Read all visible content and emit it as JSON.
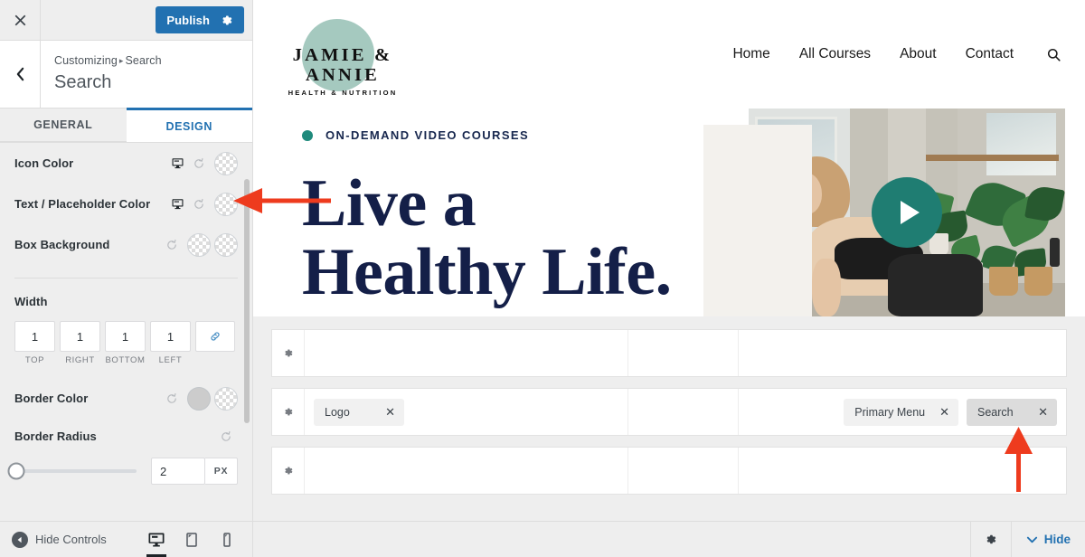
{
  "customizer": {
    "close_icon": "close-icon",
    "publish_label": "Publish",
    "publish_gear_icon": "gear-icon",
    "back_icon": "chevron-left-icon",
    "breadcrumb_prefix": "Customizing",
    "breadcrumb_separator": "▸",
    "breadcrumb_current": "Search",
    "panel_title": "Search",
    "tabs": [
      {
        "label": "GENERAL",
        "active": false
      },
      {
        "label": "DESIGN",
        "active": true
      }
    ],
    "controls": [
      {
        "label": "Icon Color",
        "responsive_icon": "desktop-icon",
        "reset_icon": "reset-icon",
        "swatches": [
          "transparent"
        ]
      },
      {
        "label": "Text / Placeholder Color",
        "responsive_icon": "desktop-icon",
        "reset_icon": "reset-icon",
        "swatches": [
          "transparent"
        ]
      },
      {
        "label": "Box Background",
        "responsive_icon": null,
        "reset_icon": "reset-icon",
        "swatches": [
          "transparent",
          "transparent"
        ]
      }
    ],
    "width": {
      "title": "Width",
      "fields": [
        {
          "value": "1",
          "caption": "TOP"
        },
        {
          "value": "1",
          "caption": "RIGHT"
        },
        {
          "value": "1",
          "caption": "BOTTOM"
        },
        {
          "value": "1",
          "caption": "LEFT"
        }
      ],
      "link_icon": "link-icon"
    },
    "border_color": {
      "label": "Border Color",
      "reset_icon": "reset-icon",
      "swatches": [
        "#cccccc",
        "transparent"
      ]
    },
    "border_radius": {
      "label": "Border Radius",
      "reset_icon": "reset-icon",
      "value": "2",
      "unit": "PX",
      "slider_percent": 2
    },
    "footer": {
      "hide_controls_label": "Hide Controls",
      "collapse_icon": "collapse-left-icon",
      "devices": [
        {
          "name": "desktop-icon",
          "active": true
        },
        {
          "name": "tablet-icon",
          "active": false
        },
        {
          "name": "mobile-icon",
          "active": false
        }
      ]
    }
  },
  "site": {
    "logo": {
      "name": "JAMIE & ANNIE",
      "tagline": "HEALTH & NUTRITION",
      "blob_color": "#a5c9bf"
    },
    "nav": [
      {
        "label": "Home"
      },
      {
        "label": "All Courses"
      },
      {
        "label": "About"
      },
      {
        "label": "Contact"
      }
    ],
    "nav_search_icon": "search-icon",
    "hero": {
      "eyebrow": "ON-DEMAND VIDEO COURSES",
      "eyebrow_dot_color": "#1f8a7c",
      "headline_line1": "Live a",
      "headline_line2": "Healthy Life.",
      "headline_color": "#141f48",
      "play_icon": "play-icon",
      "play_color": "#1f7d72"
    }
  },
  "builder": {
    "rows": [
      {
        "gear_icon": "gear-icon",
        "col1_items": [],
        "col2_items": [],
        "col3_items": []
      },
      {
        "gear_icon": "gear-icon",
        "col1_items": [
          {
            "label": "Logo",
            "selected": false,
            "remove_icon": "close-icon"
          }
        ],
        "col2_items": [],
        "col3_items": [
          {
            "label": "Primary Menu",
            "selected": false,
            "remove_icon": "close-icon"
          },
          {
            "label": "Search",
            "selected": true,
            "remove_icon": "close-icon"
          }
        ]
      },
      {
        "gear_icon": "gear-icon",
        "col1_items": [],
        "col2_items": [],
        "col3_items": []
      }
    ],
    "footer": {
      "gear_icon": "gear-icon",
      "hide_label": "Hide",
      "hide_icon": "chevron-down-icon",
      "hide_color": "#2271b1"
    }
  },
  "annotations": {
    "color": "#ee3b1e",
    "arrows": [
      {
        "name": "arrow-to-text-placeholder-color",
        "direction": "left"
      },
      {
        "name": "arrow-to-search-item",
        "direction": "up"
      }
    ]
  }
}
